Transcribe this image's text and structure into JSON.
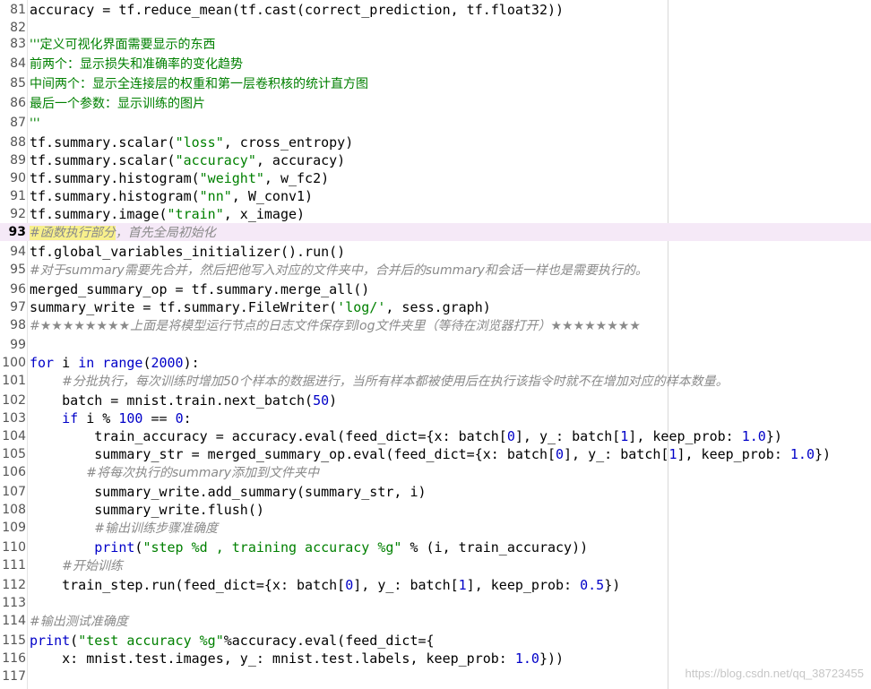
{
  "lines": [
    {
      "n": "81",
      "segs": [
        {
          "t": "accuracy = tf.reduce_mean(tf.cast(correct_prediction, tf.float32))"
        }
      ]
    },
    {
      "n": "82",
      "segs": []
    },
    {
      "n": "83",
      "segs": [
        {
          "t": "'''定义可视化界面需要显示的东西",
          "c": "doc"
        }
      ]
    },
    {
      "n": "84",
      "segs": [
        {
          "t": "前两个：显示损失和准确率的变化趋势",
          "c": "doc"
        }
      ]
    },
    {
      "n": "85",
      "segs": [
        {
          "t": "中间两个：显示全连接层的权重和第一层卷积核的统计直方图",
          "c": "doc"
        }
      ]
    },
    {
      "n": "86",
      "segs": [
        {
          "t": "最后一个参数：显示训练的图片",
          "c": "doc"
        }
      ]
    },
    {
      "n": "87",
      "segs": [
        {
          "t": "'''",
          "c": "doc"
        }
      ]
    },
    {
      "n": "88",
      "segs": [
        {
          "t": "tf.summary.scalar("
        },
        {
          "t": "\"loss\"",
          "c": "str"
        },
        {
          "t": ", cross_entropy)"
        }
      ]
    },
    {
      "n": "89",
      "segs": [
        {
          "t": "tf.summary.scalar("
        },
        {
          "t": "\"accuracy\"",
          "c": "str"
        },
        {
          "t": ", accuracy)"
        }
      ]
    },
    {
      "n": "90",
      "segs": [
        {
          "t": "tf.summary.histogram("
        },
        {
          "t": "\"weight\"",
          "c": "str"
        },
        {
          "t": ", w_fc2)"
        }
      ]
    },
    {
      "n": "91",
      "segs": [
        {
          "t": "tf.summary.histogram("
        },
        {
          "t": "\"nn\"",
          "c": "str"
        },
        {
          "t": ", W_conv1)"
        }
      ]
    },
    {
      "n": "92",
      "segs": [
        {
          "t": "tf.summary.image("
        },
        {
          "t": "\"train\"",
          "c": "str"
        },
        {
          "t": ", x_image)"
        }
      ]
    },
    {
      "n": "93",
      "cur": true,
      "segs": [
        {
          "t": "#函数执行部分",
          "c": "cm hl"
        },
        {
          "t": "，首先全局初始化",
          "c": "cm"
        }
      ]
    },
    {
      "n": "94",
      "segs": [
        {
          "t": "tf.global_variables_initializer().run()"
        }
      ]
    },
    {
      "n": "95",
      "segs": [
        {
          "t": "#对于summary需要先合并，然后把他写入对应的文件夹中，合并后的summary和会话一样也是需要执行的。",
          "c": "cm"
        }
      ]
    },
    {
      "n": "96",
      "segs": [
        {
          "t": "merged_summary_op = tf.summary.merge_all()"
        }
      ]
    },
    {
      "n": "97",
      "segs": [
        {
          "t": "summary_write = tf.summary.FileWriter("
        },
        {
          "t": "'log/'",
          "c": "str"
        },
        {
          "t": ", sess.graph)"
        }
      ]
    },
    {
      "n": "98",
      "segs": [
        {
          "t": "#★★★★★★★★上面是将模型运行节点的日志文件保存到log文件夹里（等待在浏览器打开）★★★★★★★★",
          "c": "cm"
        }
      ]
    },
    {
      "n": "99",
      "segs": []
    },
    {
      "n": "100",
      "segs": [
        {
          "t": "for",
          "c": "kw"
        },
        {
          "t": " i "
        },
        {
          "t": "in",
          "c": "kw"
        },
        {
          "t": " "
        },
        {
          "t": "range",
          "c": "kw"
        },
        {
          "t": "("
        },
        {
          "t": "2000",
          "c": "num"
        },
        {
          "t": "):"
        }
      ]
    },
    {
      "n": "101",
      "segs": [
        {
          "t": "    "
        },
        {
          "t": "#分批执行，每次训练时增加50个样本的数据进行，当所有样本都被使用后在执行该指令时就不在增加对应的样本数量。",
          "c": "cm"
        }
      ]
    },
    {
      "n": "102",
      "segs": [
        {
          "t": "    batch = mnist.train.next_batch("
        },
        {
          "t": "50",
          "c": "num"
        },
        {
          "t": ")"
        }
      ]
    },
    {
      "n": "103",
      "segs": [
        {
          "t": "    "
        },
        {
          "t": "if",
          "c": "kw"
        },
        {
          "t": " i % "
        },
        {
          "t": "100",
          "c": "num"
        },
        {
          "t": " == "
        },
        {
          "t": "0",
          "c": "num"
        },
        {
          "t": ":"
        }
      ]
    },
    {
      "n": "104",
      "segs": [
        {
          "t": "        train_accuracy = accuracy.eval(feed_dict={x: batch["
        },
        {
          "t": "0",
          "c": "num"
        },
        {
          "t": "], y_: batch["
        },
        {
          "t": "1",
          "c": "num"
        },
        {
          "t": "], keep_prob: "
        },
        {
          "t": "1.0",
          "c": "num"
        },
        {
          "t": "})"
        }
      ]
    },
    {
      "n": "105",
      "segs": [
        {
          "t": "        summary_str = merged_summary_op.eval(feed_dict={x: batch["
        },
        {
          "t": "0",
          "c": "num"
        },
        {
          "t": "], y_: batch["
        },
        {
          "t": "1",
          "c": "num"
        },
        {
          "t": "], keep_prob: "
        },
        {
          "t": "1.0",
          "c": "num"
        },
        {
          "t": "})"
        }
      ]
    },
    {
      "n": "106",
      "segs": [
        {
          "t": "       "
        },
        {
          "t": "#将每次执行的summary添加到文件夹中",
          "c": "cm"
        }
      ]
    },
    {
      "n": "107",
      "segs": [
        {
          "t": "        summary_write.add_summary(summary_str, i)"
        }
      ]
    },
    {
      "n": "108",
      "segs": [
        {
          "t": "        summary_write.flush()"
        }
      ]
    },
    {
      "n": "109",
      "segs": [
        {
          "t": "        "
        },
        {
          "t": "#输出训练步骤准确度",
          "c": "cm"
        }
      ]
    },
    {
      "n": "110",
      "segs": [
        {
          "t": "        "
        },
        {
          "t": "print",
          "c": "kw"
        },
        {
          "t": "("
        },
        {
          "t": "\"step %d , training accuracy %g\"",
          "c": "str"
        },
        {
          "t": " % (i, train_accuracy))"
        }
      ]
    },
    {
      "n": "111",
      "segs": [
        {
          "t": "    "
        },
        {
          "t": "#开始训练",
          "c": "cm"
        }
      ]
    },
    {
      "n": "112",
      "segs": [
        {
          "t": "    train_step.run(feed_dict={x: batch["
        },
        {
          "t": "0",
          "c": "num"
        },
        {
          "t": "], y_: batch["
        },
        {
          "t": "1",
          "c": "num"
        },
        {
          "t": "], keep_prob: "
        },
        {
          "t": "0.5",
          "c": "num"
        },
        {
          "t": "})"
        }
      ]
    },
    {
      "n": "113",
      "segs": []
    },
    {
      "n": "114",
      "segs": [
        {
          "t": "#输出测试准确度",
          "c": "cm"
        }
      ]
    },
    {
      "n": "115",
      "segs": [
        {
          "t": "print",
          "c": "kw"
        },
        {
          "t": "("
        },
        {
          "t": "\"test accuracy %g\"",
          "c": "str"
        },
        {
          "t": "%accuracy.eval(feed_dict={"
        }
      ]
    },
    {
      "n": "116",
      "segs": [
        {
          "t": "    x: mnist.test.images, y_: mnist.test.labels, keep_prob: "
        },
        {
          "t": "1.0",
          "c": "num"
        },
        {
          "t": "}))"
        }
      ]
    },
    {
      "n": "117",
      "segs": []
    }
  ],
  "watermark": "https://blog.csdn.net/qq_38723455"
}
